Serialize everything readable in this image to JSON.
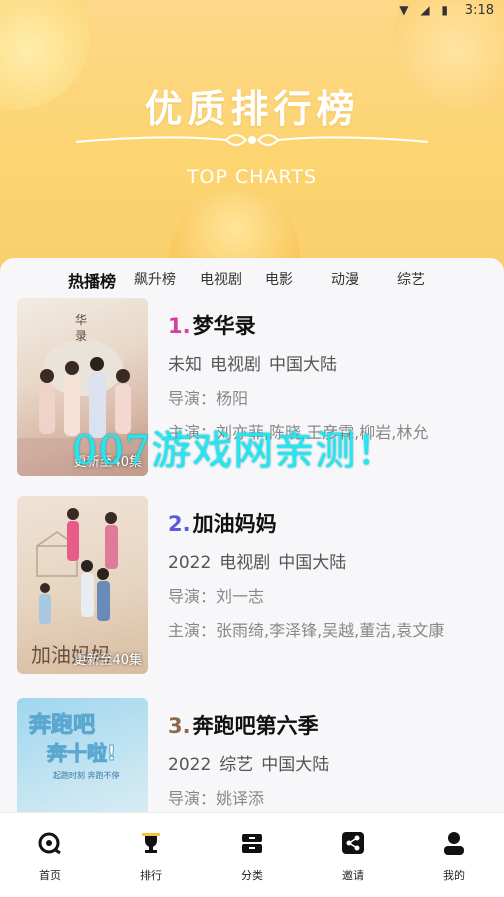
{
  "status": {
    "time": "3:18",
    "icons": "▼ ◢ ▮"
  },
  "hero": {
    "title": "优质排行榜",
    "subtitle": "TOP CHARTS"
  },
  "tabs": [
    "热播榜",
    "飙升榜",
    "电视剧",
    "电影",
    "动漫",
    "综艺"
  ],
  "items": [
    {
      "rank": "1.",
      "rank_color": "#d63fa0",
      "title": "梦华录",
      "year": "未知",
      "type": "电视剧",
      "region": "中国大陆",
      "director": "导演：杨阳",
      "cast": "主演：刘亦菲,陈晓,王彦霖,柳岩,林允",
      "episodes": "更新至40集"
    },
    {
      "rank": "2.",
      "rank_color": "#5b5ad8",
      "title": "加油妈妈",
      "year": "2022",
      "type": "电视剧",
      "region": "中国大陆",
      "director": "导演：刘一志",
      "cast": "主演：张雨绮,李泽锋,吴越,董洁,袁文康",
      "episodes": "更新至40集"
    },
    {
      "rank": "3.",
      "rank_color": "#8a6a4a",
      "title": "奔跑吧第六季",
      "year": "2022",
      "type": "综艺",
      "region": "中国大陆",
      "director": "导演：姚译添",
      "cast": "",
      "episodes": ""
    }
  ],
  "watermark": "007游戏网亲测！",
  "nav": [
    "首页",
    "排行",
    "分类",
    "邀请",
    "我的"
  ]
}
